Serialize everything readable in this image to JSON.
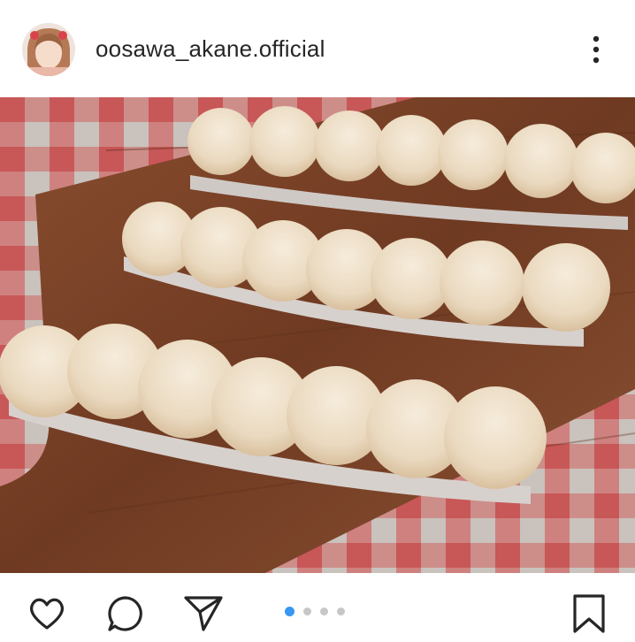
{
  "post": {
    "username": "oosawa_akane.official"
  },
  "icons": {
    "more": "more-vertical-icon",
    "like": "heart-icon",
    "comment": "comment-icon",
    "share": "send-icon",
    "save": "bookmark-icon"
  },
  "carousel": {
    "total": 4,
    "active_index": 0
  },
  "colors": {
    "accent": "#3897f0",
    "inactive_dot": "#c7c7c7",
    "text": "#262626"
  }
}
